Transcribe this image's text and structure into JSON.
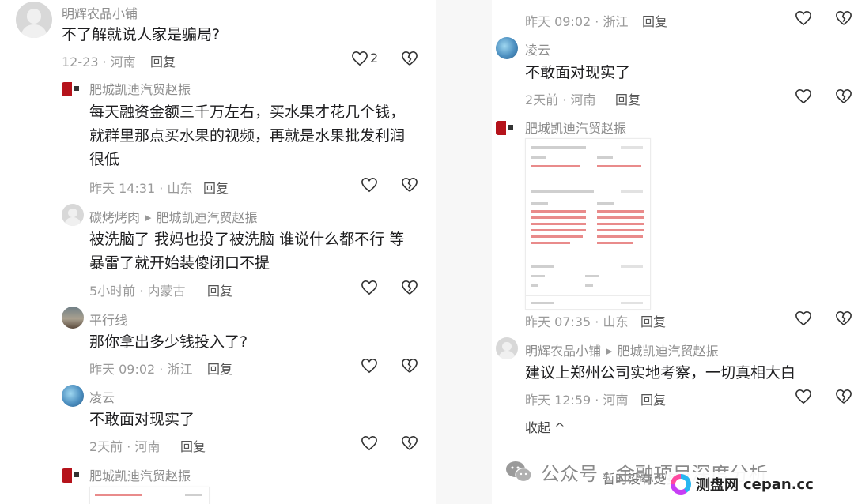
{
  "left": {
    "comments": [
      {
        "name": "明辉农品小铺",
        "text_lines": [
          "不了解就说人家是骗局?"
        ],
        "date": "12-23 · 河南",
        "reply": "回复",
        "likes": "2"
      },
      {
        "name": "肥城凯迪汽贸赵振",
        "text_lines": [
          "每天融资金额三千万左右，买水果才花几个钱，",
          "就群里那点买水果的视频，再就是水果批发利润",
          "很低"
        ],
        "date": "昨天 14:31 · 山东",
        "reply": "回复"
      },
      {
        "name": "碳烤烤肉",
        "reply_to": "肥城凯迪汽贸赵振",
        "text_lines": [
          "被洗脑了 我妈也投了被洗脑 谁说什么都不行 等",
          "暴雷了就开始装傻闭口不提"
        ],
        "date": "5小时前 · 内蒙古",
        "reply": "回复"
      },
      {
        "name": "平行线",
        "text_lines": [
          "那你拿出多少钱投入了?"
        ],
        "date": "昨天 09:02 · 浙江",
        "reply": "回复"
      },
      {
        "name": "凌云",
        "text_lines": [
          "不敢面对现实了"
        ],
        "date": "2天前 · 河南",
        "reply": "回复"
      },
      {
        "name": "肥城凯迪汽贸赵振"
      }
    ]
  },
  "right": {
    "top_meta": {
      "date": "昨天 09:02 · 浙江",
      "reply": "回复"
    },
    "comments": [
      {
        "name": "凌云",
        "text_lines": [
          "不敢面对现实了"
        ],
        "date": "2天前 · 河南",
        "reply": "回复"
      },
      {
        "name": "肥城凯迪汽贸赵振",
        "date": "昨天 07:35 · 山东",
        "reply": "回复"
      },
      {
        "name": "明辉农品小铺",
        "reply_to": "肥城凯迪汽贸赵振",
        "text_lines": [
          "建议上郑州公司实地考察，一切真相大白"
        ],
        "date": "昨天 12:59 · 河南",
        "reply": "回复"
      }
    ],
    "collapse_label": "收起 ^"
  },
  "watermark": {
    "text": "公众号 · 金融项目深度分析",
    "icon": "wechat-icon"
  },
  "bottom_hint": "暂时没有更多了",
  "site_badge": {
    "cn": "测盘网",
    "en": "cepan.cc"
  },
  "colors": {
    "meta": "#9a9a9a",
    "name": "#8d8d8d",
    "text": "#1d1d1f",
    "avatar_red": "#b5131b"
  }
}
